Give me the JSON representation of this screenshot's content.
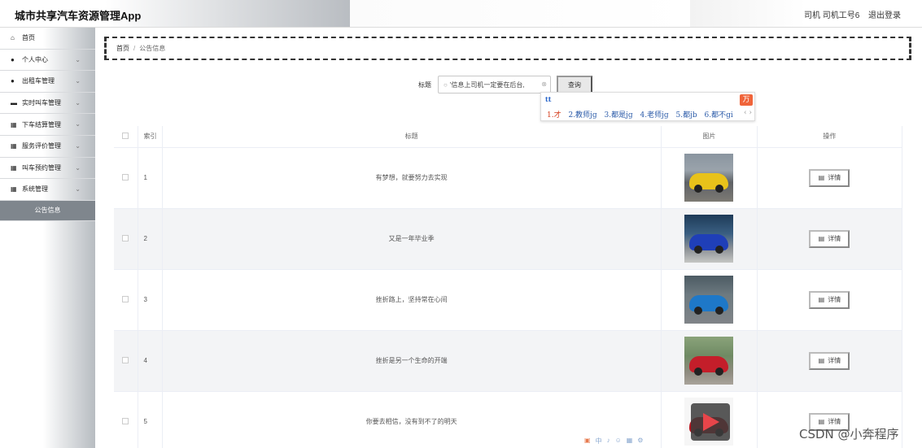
{
  "header": {
    "app_title": "城市共享汽车资源管理App",
    "user_info": "司机 司机工号6",
    "logout_label": "退出登录"
  },
  "sidebar": {
    "items": [
      {
        "label": "首页",
        "icon": "home-icon",
        "glyph": "⌂",
        "chevron": false
      },
      {
        "label": "个人中心",
        "icon": "user-icon",
        "glyph": "●",
        "chevron": true
      },
      {
        "label": "出租车管理",
        "icon": "user-icon",
        "glyph": "●",
        "chevron": true
      },
      {
        "label": "实时叫车管理",
        "icon": "monitor-icon",
        "glyph": "▬",
        "chevron": true
      },
      {
        "label": "下车结算管理",
        "icon": "grid-icon",
        "glyph": "▦",
        "chevron": true
      },
      {
        "label": "服务评价管理",
        "icon": "grid-icon",
        "glyph": "▦",
        "chevron": true
      },
      {
        "label": "叫车预约管理",
        "icon": "grid-icon",
        "glyph": "▦",
        "chevron": true
      },
      {
        "label": "系统管理",
        "icon": "grid-icon",
        "glyph": "▦",
        "chevron": true
      }
    ],
    "active_item": "公告信息"
  },
  "breadcrumb": {
    "home": "首页",
    "separator": "/",
    "current": "公告信息"
  },
  "search": {
    "label": "标题",
    "value": "'信息上司机一定要在后台,",
    "button_label": "查询"
  },
  "ime": {
    "pinyin": "tt",
    "candidates": [
      "1.才",
      "2.教师jg",
      "3.都是jg",
      "4.老师jg",
      "5.都jb",
      "6.都不gi"
    ],
    "nav": "‹ ›"
  },
  "table": {
    "headers": {
      "index": "索引",
      "title": "标题",
      "image": "图片",
      "action": "操作"
    },
    "detail_label": "详情",
    "rows": [
      {
        "index": "1",
        "title": "有梦想，就要努力去实现",
        "car_color": "#e8c21a"
      },
      {
        "index": "2",
        "title": "又是一年毕业季",
        "car_color": "#1f3fb8"
      },
      {
        "index": "3",
        "title": "挫折路上，坚持常在心间",
        "car_color": "#1e78c8"
      },
      {
        "index": "4",
        "title": "挫折是另一个生命的开端",
        "car_color": "#c41e2a"
      },
      {
        "index": "5",
        "title": "你要去相信，没有到不了的明天",
        "car_color": "#b8141e"
      }
    ]
  },
  "watermark": "CSDN @小奔程序"
}
